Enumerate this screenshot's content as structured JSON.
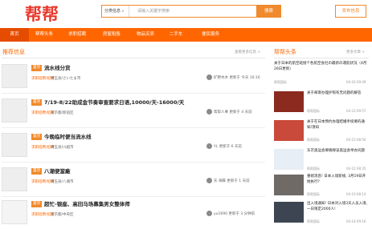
{
  "header": {
    "logo_alt": "帮帮",
    "search_category": "分类信息",
    "search_placeholder": "请输入关键字搜索",
    "search_button": "搜索",
    "post_button": "发布信息"
  },
  "nav": [
    "首页",
    "帮帮头条",
    "求职招聘",
    "房屋租售",
    "物品买卖",
    "二手车",
    "便民服务"
  ],
  "recommend": {
    "title": "推荐信息",
    "more": "查看更多信息 >",
    "items": [
      {
        "badge": "置顶",
        "title": "流水线分货",
        "category": "求职招聘/招聘",
        "location": "埼玉县/さいたま市",
        "user": "矿野木木",
        "time": "更新于 今天 16:16"
      },
      {
        "badge": "置顶",
        "title": "7/19-8/22助成金节奏审查要求日语,10000/天-16000/天",
        "category": "求职招聘/招聘",
        "location": "东京都/新宿区",
        "user": "帮帮人事",
        "time": "更新于 4 天前"
      },
      {
        "badge": "置顶",
        "title": "今晚临时便当流水线",
        "category": "求职招聘/招聘",
        "location": "埼玉县/川越市",
        "user": "YL",
        "time": "更新于 6 天前"
      },
      {
        "badge": "置顶",
        "title": "八潮便當廠",
        "category": "求职招聘/招聘",
        "location": "埼玉县/八潮市",
        "user": "矢 海蝶",
        "time": "更新于 1 天前"
      },
      {
        "badge": "置顶",
        "title": "超忙-银座、高田马场募集男女整体师",
        "category": "求职招聘/招聘",
        "location": "东京都/中央区",
        "user": "yu1690",
        "time": "更新于 3 分钟前"
      }
    ]
  },
  "headlines": {
    "title": "帮帮头条",
    "more": "更多文章 >",
    "items": [
      {
        "title": "关于日本的航空班接个各航空会社の最新の運航状況（4月26日更新）",
        "source": "帮帮国际",
        "time": "04-26 09:49"
      },
      {
        "title": "关于邮寄办理护照有无问题的解答",
        "source": "帮帮国际",
        "time": "04-23 09:57"
      },
      {
        "title": "关于在日本预约办理结婚手续要的通知/须知",
        "source": "帮帮国际",
        "time": "04-23 08:56"
      },
      {
        "title": "东京奥运会要确保该奥运会举办问题",
        "source": "帮帮国际",
        "time": "04-22 08:35"
      },
      {
        "title": "重磅消息! 日本入境新规, 3月19日开始执行?",
        "source": "帮帮国际",
        "time": "04-19 08:14"
      },
      {
        "title": "出入境通知! 日本对入境3天入员入境, 一日限定2000人!",
        "source": "帮帮国际",
        "time": "04-18 09:16"
      }
    ]
  },
  "colors": {
    "accent": "#ff6600",
    "nav": "#ff6600",
    "search": "#f08a2c"
  }
}
